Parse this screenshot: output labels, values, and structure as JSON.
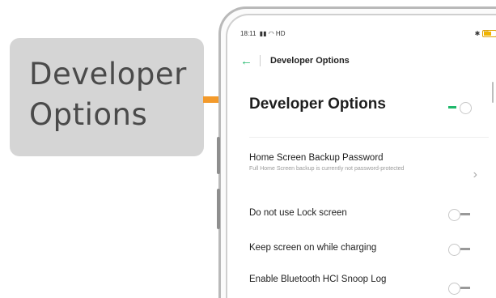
{
  "callout": {
    "text": "Developer\nOptions"
  },
  "status_bar": {
    "time": "18:11",
    "network": "HD",
    "battery": "77"
  },
  "topbar": {
    "title": "Developer Options"
  },
  "section": {
    "title": "Developer Options",
    "toggle_on": true
  },
  "items": [
    {
      "title": "Home Screen Backup Password",
      "desc": "Full Home Screen backup is currently not password-protected"
    },
    {
      "title": "Do not use Lock screen",
      "toggle_on": false
    },
    {
      "title": "Keep screen on while charging",
      "toggle_on": false
    },
    {
      "title": "Enable Bluetooth HCI Snoop Log",
      "toggle_on": false
    }
  ],
  "colors": {
    "accent": "#1fb86b",
    "arrow": "#f39a2b",
    "callout_bg": "#d5d5d5"
  }
}
